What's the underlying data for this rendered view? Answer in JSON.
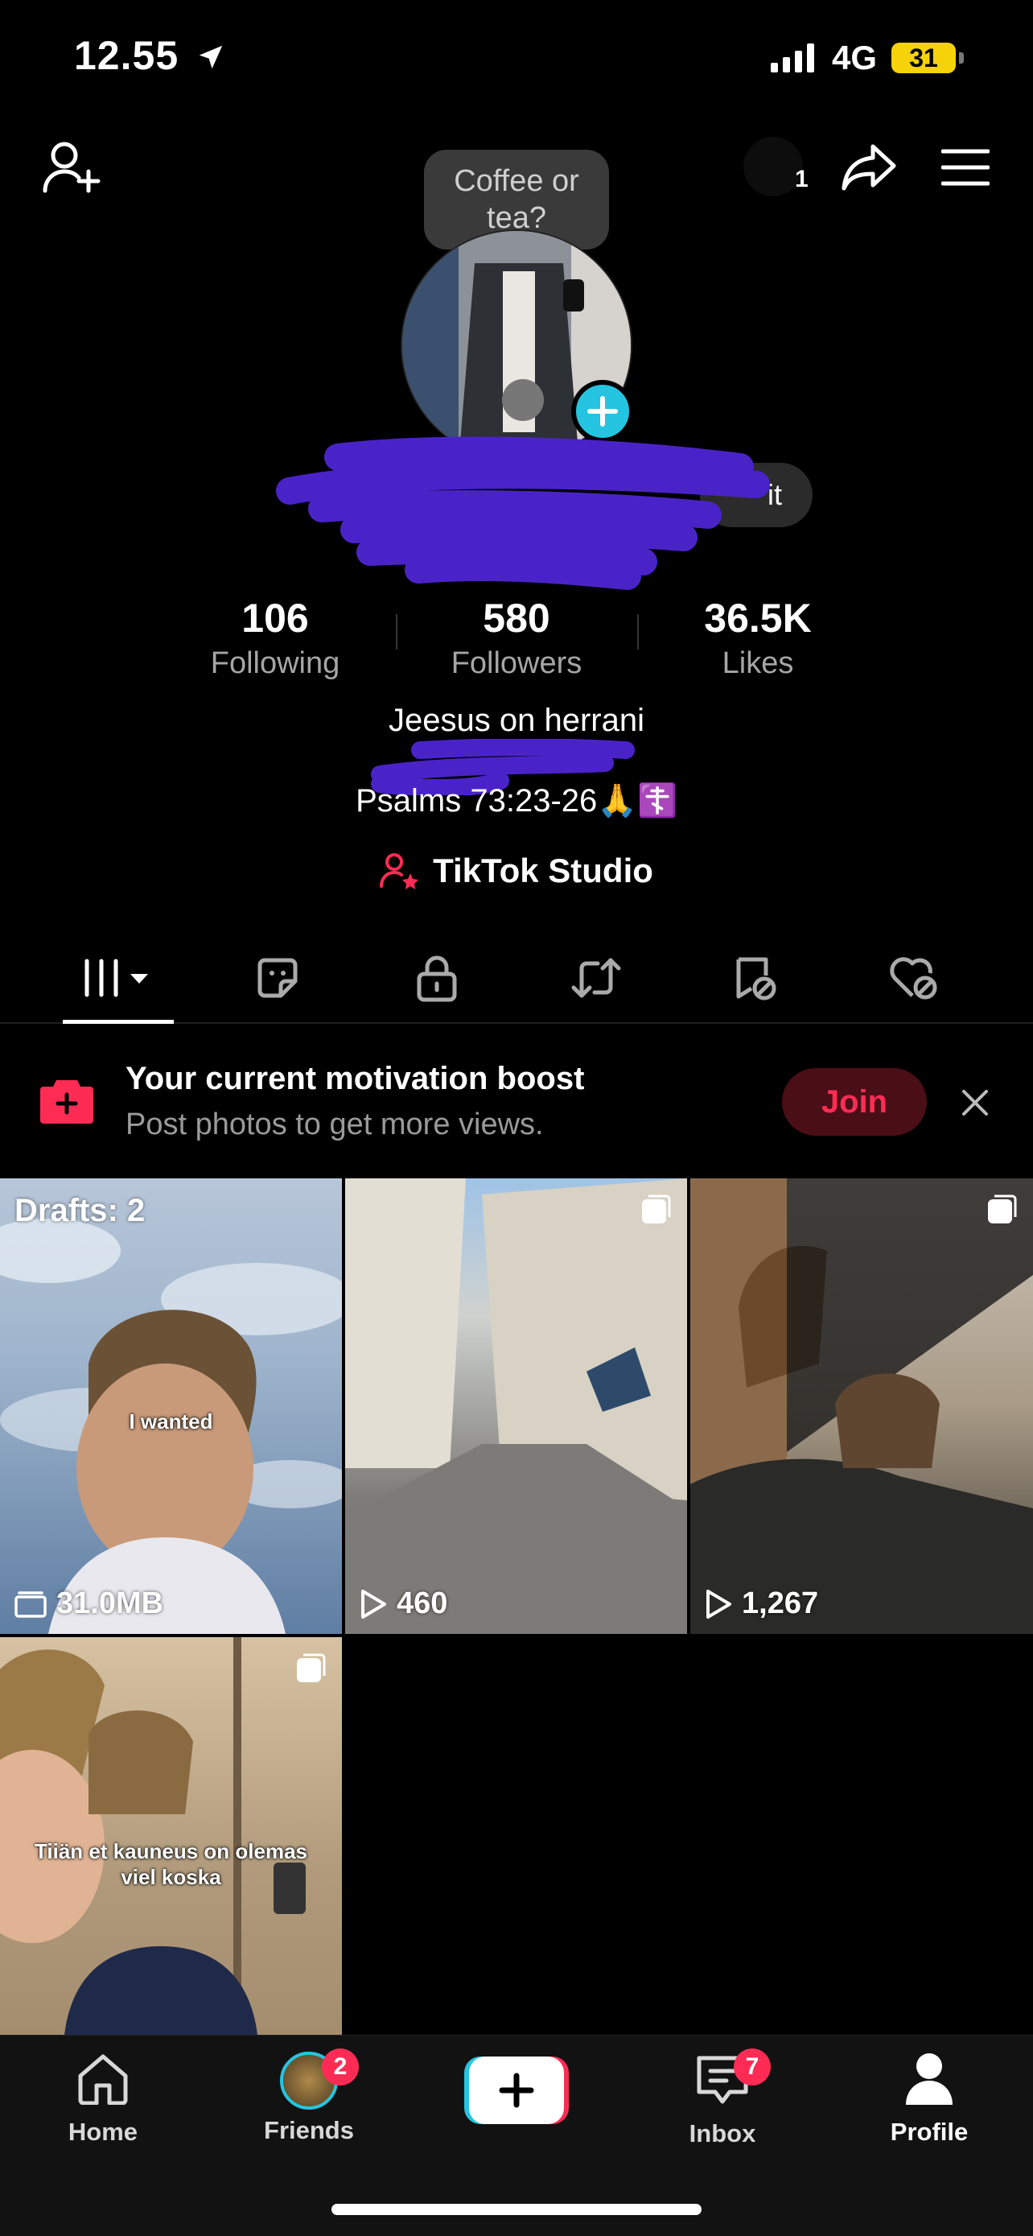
{
  "status_bar": {
    "time": "12.55",
    "network": "4G",
    "battery": "31"
  },
  "header": {
    "note_bubble": "Coffee or tea?",
    "notification_count": "1",
    "edit_button": "it"
  },
  "stats": [
    {
      "value": "106",
      "label": "Following"
    },
    {
      "value": "580",
      "label": "Followers"
    },
    {
      "value": "36.5K",
      "label": "Likes"
    }
  ],
  "bio": {
    "line1": "Jeesus on herrani",
    "line3": "Psalms 73:23-26🙏☦️"
  },
  "studio": {
    "label": "TikTok Studio"
  },
  "banner": {
    "title": "Your current motivation boost",
    "subtitle": "Post photos to get more views.",
    "join": "Join"
  },
  "grid": [
    {
      "overlay": "Drafts: 2",
      "caption": "I wanted",
      "meta": "31.0MB"
    },
    {
      "meta": "460"
    },
    {
      "meta": "1,267"
    },
    {
      "caption": "Tiiän et kauneus on olemas viel koska"
    }
  ],
  "nav": {
    "home": "Home",
    "friends": "Friends",
    "friends_badge": "2",
    "inbox": "Inbox",
    "inbox_badge": "7",
    "profile": "Profile"
  },
  "colors": {
    "accent": "#fe2c55",
    "cyan": "#25c4e0",
    "scribble": "#4a23c8"
  }
}
